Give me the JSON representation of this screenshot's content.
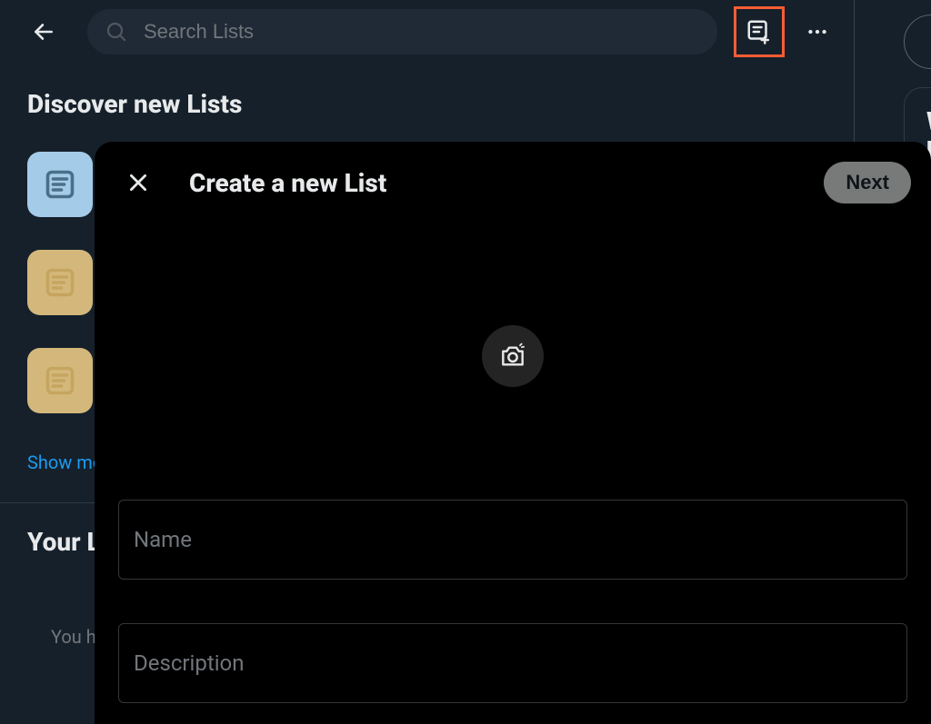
{
  "header": {
    "search_placeholder": "Search Lists"
  },
  "discover": {
    "heading": "Discover new Lists",
    "show_more_label": "Show more"
  },
  "your_lists": {
    "heading": "Your Lists",
    "empty_message": "You haven't created or followed any Lists. When you do, they'll show up here."
  },
  "right_panel": {
    "card_heading": "What's happening"
  },
  "modal": {
    "title": "Create a new List",
    "next_label": "Next",
    "name_label": "Name",
    "description_label": "Description"
  }
}
